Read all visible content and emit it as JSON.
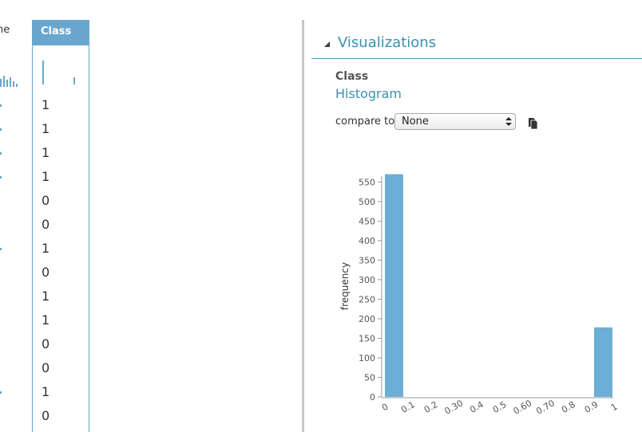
{
  "table": {
    "prev_column_header_fragment": "ne",
    "class_column": {
      "header": "Class",
      "values": [
        "1",
        "1",
        "1",
        "1",
        "0",
        "0",
        "1",
        "0",
        "1",
        "1",
        "0",
        "0",
        "1",
        "0"
      ]
    }
  },
  "visualizations": {
    "title": "Visualizations",
    "column_name": "Class",
    "viz_type": "Histogram",
    "compare_to_label": "compare to",
    "compare_to_value": "None"
  },
  "chart_data": {
    "type": "bar",
    "title": "",
    "xlabel": "",
    "ylabel": "frequency",
    "ylim": [
      0,
      570
    ],
    "yticks": [
      "0",
      "50",
      "100",
      "150",
      "200",
      "250",
      "300",
      "350",
      "400",
      "450",
      "500",
      "550"
    ],
    "x_ticks": [
      "0",
      "0.1",
      "0.2",
      "0.30",
      "0.4",
      "0.5",
      "0.60",
      "0.70",
      "0.8",
      "0.9",
      "1"
    ],
    "bins": [
      {
        "label": "0",
        "value": 570
      },
      {
        "label": "0.9",
        "value": 178
      }
    ],
    "grid": false,
    "colors": {
      "bar": "#6baed6"
    }
  },
  "colors": {
    "accent": "#3c8fb3",
    "column_highlight": "#6aa7cf"
  }
}
